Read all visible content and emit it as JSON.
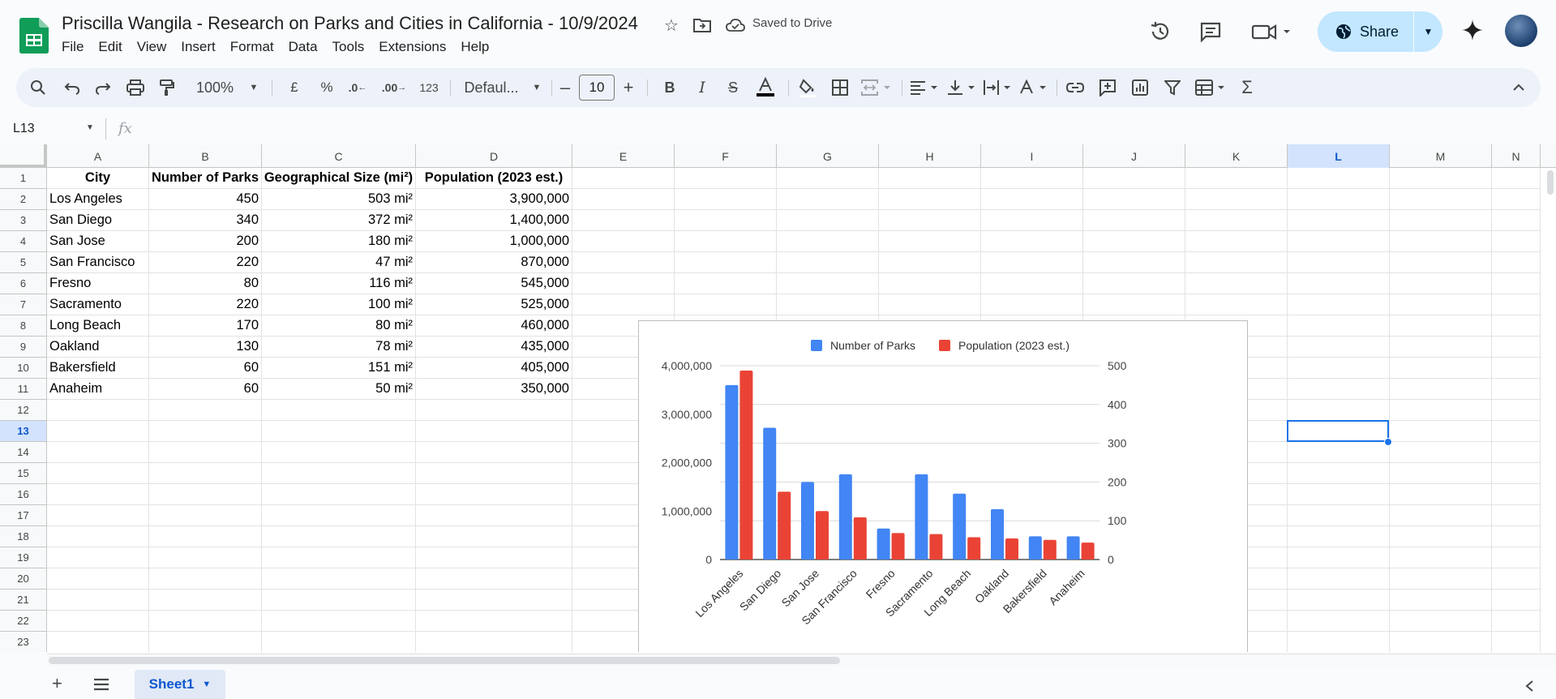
{
  "doc": {
    "title": "Priscilla Wangila - Research on Parks and Cities in California - 10/9/2024",
    "saved_status": "Saved to Drive",
    "share_label": "Share"
  },
  "menu": [
    "File",
    "Edit",
    "View",
    "Insert",
    "Format",
    "Data",
    "Tools",
    "Extensions",
    "Help"
  ],
  "toolbar": {
    "zoom": "100%",
    "currency": "£",
    "percent": "%",
    "dec_decrease": ".0",
    "dec_increase": ".00",
    "number_format": "123",
    "font": "Defaul...",
    "font_size": "10"
  },
  "formula_bar": {
    "cell_ref": "L13",
    "fx": "fx"
  },
  "grid": {
    "columns": [
      "A",
      "B",
      "C",
      "D",
      "E",
      "F",
      "G",
      "H",
      "I",
      "J",
      "K",
      "L",
      "M",
      "N"
    ],
    "selected_column": "L",
    "rows": [
      "1",
      "2",
      "3",
      "4",
      "5",
      "6",
      "7",
      "8",
      "9",
      "10",
      "11",
      "12",
      "13",
      "14",
      "15",
      "16",
      "17",
      "18",
      "19",
      "20",
      "21",
      "22",
      "23"
    ],
    "selected_row": "13",
    "headers": [
      "City",
      "Number of Parks",
      "Geographical Size (mi²)",
      "Population (2023 est.)"
    ],
    "data": [
      [
        "Los Angeles",
        "450",
        "503 mi²",
        "3,900,000"
      ],
      [
        "San Diego",
        "340",
        "372 mi²",
        "1,400,000"
      ],
      [
        "San Jose",
        "200",
        "180 mi²",
        "1,000,000"
      ],
      [
        "San Francisco",
        "220",
        "47 mi²",
        "870,000"
      ],
      [
        "Fresno",
        "80",
        "116 mi²",
        "545,000"
      ],
      [
        "Sacramento",
        "220",
        "100 mi²",
        "525,000"
      ],
      [
        "Long Beach",
        "170",
        "80 mi²",
        "460,000"
      ],
      [
        "Oakland",
        "130",
        "78 mi²",
        "435,000"
      ],
      [
        "Bakersfield",
        "60",
        "151 mi²",
        "405,000"
      ],
      [
        "Anaheim",
        "60",
        "50 mi²",
        "350,000"
      ]
    ]
  },
  "chart_data": {
    "type": "bar",
    "categories": [
      "Los Angeles",
      "San Diego",
      "San Jose",
      "San Francisco",
      "Fresno",
      "Sacramento",
      "Long Beach",
      "Oakland",
      "Bakersfield",
      "Anaheim"
    ],
    "series": [
      {
        "name": "Number of Parks",
        "axis": "right",
        "color": "#4285f4",
        "values": [
          450,
          340,
          200,
          220,
          80,
          220,
          170,
          130,
          60,
          60
        ]
      },
      {
        "name": "Population (2023 est.)",
        "axis": "left",
        "color": "#ea4335",
        "values": [
          3900000,
          1400000,
          1000000,
          870000,
          545000,
          525000,
          460000,
          435000,
          405000,
          350000
        ]
      }
    ],
    "ylim_left": [
      0,
      4000000
    ],
    "yticks_left": [
      "0",
      "1,000,000",
      "2,000,000",
      "3,000,000",
      "4,000,000"
    ],
    "ylim_right": [
      0,
      500
    ],
    "yticks_right": [
      "0",
      "100",
      "200",
      "300",
      "400",
      "500"
    ],
    "legend": "top",
    "grid": true
  },
  "sheet": {
    "tab_name": "Sheet1"
  },
  "colors": {
    "accent": "#0b57d0",
    "share_bg": "#c2e7ff",
    "selection": "#1a73e8"
  }
}
